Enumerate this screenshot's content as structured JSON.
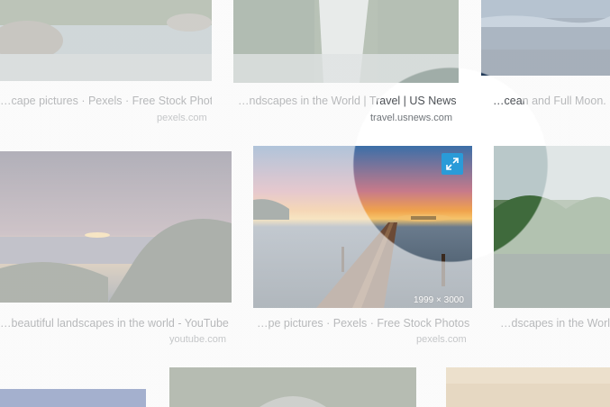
{
  "results": [
    {
      "caption": "…cape pictures · Pexels · Free Stock Photos",
      "source": "pexels.com"
    },
    {
      "caption": "…ndscapes in the World | Travel | US News",
      "source": "travel.usnews.com"
    },
    {
      "caption": "…cean and Full Moon.",
      "source": ""
    },
    {
      "caption": "…beautiful landscapes in the world - YouTube",
      "source": "youtube.com"
    },
    {
      "caption": "…pe pictures · Pexels · Free Stock Photos",
      "source": "pexels.com",
      "dimensions": "1999 × 3000"
    },
    {
      "caption": "…dscapes in the World |",
      "source": ""
    }
  ],
  "icons": {
    "expand": "expand-icon"
  },
  "colors": {
    "accent": "#2a9bd8"
  }
}
